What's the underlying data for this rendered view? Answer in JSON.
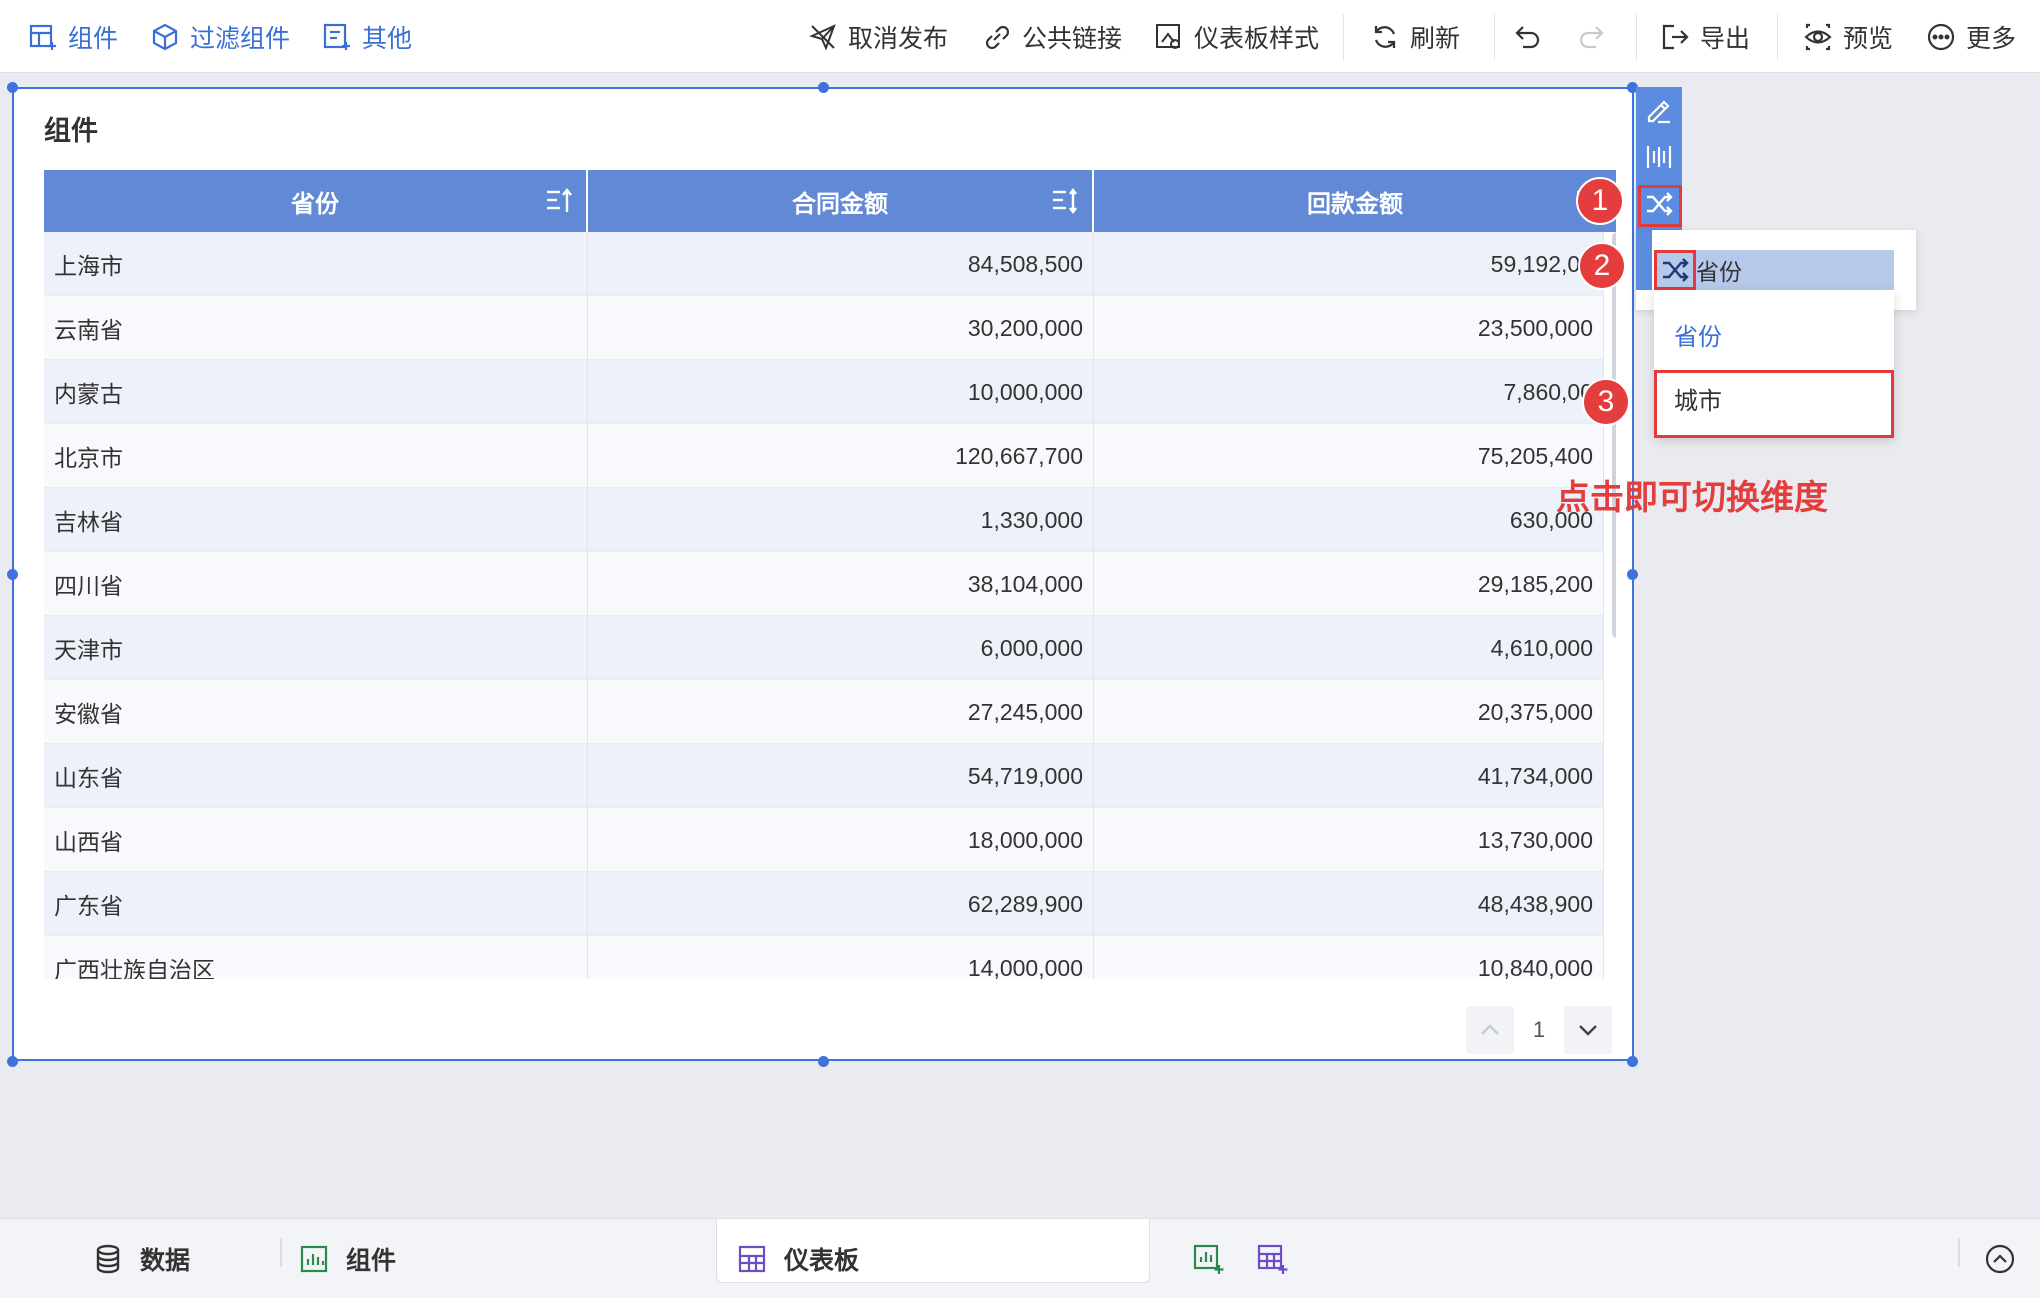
{
  "toolbar": {
    "left": [
      {
        "label": "组件",
        "icon": "add-widget-icon"
      },
      {
        "label": "过滤组件",
        "icon": "filter-widget-icon"
      },
      {
        "label": "其他",
        "icon": "other-icon"
      }
    ],
    "unpublish": "取消发布",
    "public_link": "公共链接",
    "dashboard_style": "仪表板样式",
    "refresh": "刷新",
    "export": "导出",
    "preview": "预览",
    "more": "更多"
  },
  "widget": {
    "title": "组件",
    "columns": [
      "省份",
      "合同金额",
      "回款金额"
    ],
    "rows": [
      {
        "province": "上海市",
        "contract": "84,508,500",
        "payment": "59,192,00"
      },
      {
        "province": "云南省",
        "contract": "30,200,000",
        "payment": "23,500,000"
      },
      {
        "province": "内蒙古",
        "contract": "10,000,000",
        "payment": "7,860,00"
      },
      {
        "province": "北京市",
        "contract": "120,667,700",
        "payment": "75,205,400"
      },
      {
        "province": "吉林省",
        "contract": "1,330,000",
        "payment": "630,000"
      },
      {
        "province": "四川省",
        "contract": "38,104,000",
        "payment": "29,185,200"
      },
      {
        "province": "天津市",
        "contract": "6,000,000",
        "payment": "4,610,000"
      },
      {
        "province": "安徽省",
        "contract": "27,245,000",
        "payment": "20,375,000"
      },
      {
        "province": "山东省",
        "contract": "54,719,000",
        "payment": "41,734,000"
      },
      {
        "province": "山西省",
        "contract": "18,000,000",
        "payment": "13,730,000"
      },
      {
        "province": "广东省",
        "contract": "62,289,900",
        "payment": "48,438,900"
      },
      {
        "province": "广西壮族自治区",
        "contract": "14,000,000",
        "payment": "10,840,000"
      }
    ],
    "page": "1"
  },
  "dimension_switch": {
    "current": "省份",
    "options": [
      "省份",
      "城市"
    ],
    "selected": "省份"
  },
  "annotations": {
    "steps": [
      "1",
      "2",
      "3"
    ],
    "note": "点击即可切换维度"
  },
  "bottom_tabs": {
    "data": "数据",
    "widget": "组件",
    "dashboard": "仪表板"
  },
  "colors": {
    "accent": "#3e73de",
    "header": "#6189d6",
    "annotation": "#e33d3d"
  }
}
